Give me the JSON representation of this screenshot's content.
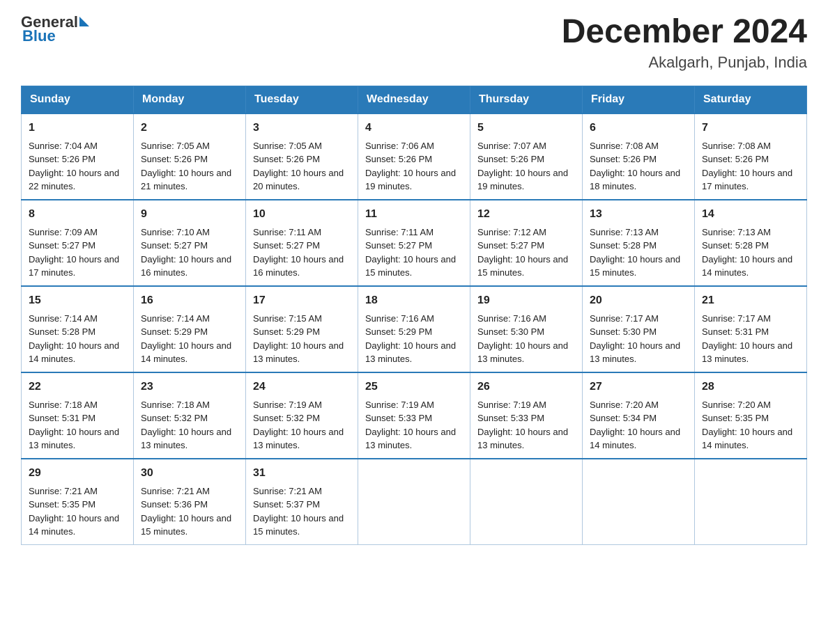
{
  "header": {
    "logo_general": "General",
    "logo_blue": "Blue",
    "title": "December 2024",
    "subtitle": "Akalgarh, Punjab, India"
  },
  "days": [
    "Sunday",
    "Monday",
    "Tuesday",
    "Wednesday",
    "Thursday",
    "Friday",
    "Saturday"
  ],
  "weeks": [
    [
      {
        "num": "1",
        "sunrise": "7:04 AM",
        "sunset": "5:26 PM",
        "daylight": "10 hours and 22 minutes."
      },
      {
        "num": "2",
        "sunrise": "7:05 AM",
        "sunset": "5:26 PM",
        "daylight": "10 hours and 21 minutes."
      },
      {
        "num": "3",
        "sunrise": "7:05 AM",
        "sunset": "5:26 PM",
        "daylight": "10 hours and 20 minutes."
      },
      {
        "num": "4",
        "sunrise": "7:06 AM",
        "sunset": "5:26 PM",
        "daylight": "10 hours and 19 minutes."
      },
      {
        "num": "5",
        "sunrise": "7:07 AM",
        "sunset": "5:26 PM",
        "daylight": "10 hours and 19 minutes."
      },
      {
        "num": "6",
        "sunrise": "7:08 AM",
        "sunset": "5:26 PM",
        "daylight": "10 hours and 18 minutes."
      },
      {
        "num": "7",
        "sunrise": "7:08 AM",
        "sunset": "5:26 PM",
        "daylight": "10 hours and 17 minutes."
      }
    ],
    [
      {
        "num": "8",
        "sunrise": "7:09 AM",
        "sunset": "5:27 PM",
        "daylight": "10 hours and 17 minutes."
      },
      {
        "num": "9",
        "sunrise": "7:10 AM",
        "sunset": "5:27 PM",
        "daylight": "10 hours and 16 minutes."
      },
      {
        "num": "10",
        "sunrise": "7:11 AM",
        "sunset": "5:27 PM",
        "daylight": "10 hours and 16 minutes."
      },
      {
        "num": "11",
        "sunrise": "7:11 AM",
        "sunset": "5:27 PM",
        "daylight": "10 hours and 15 minutes."
      },
      {
        "num": "12",
        "sunrise": "7:12 AM",
        "sunset": "5:27 PM",
        "daylight": "10 hours and 15 minutes."
      },
      {
        "num": "13",
        "sunrise": "7:13 AM",
        "sunset": "5:28 PM",
        "daylight": "10 hours and 15 minutes."
      },
      {
        "num": "14",
        "sunrise": "7:13 AM",
        "sunset": "5:28 PM",
        "daylight": "10 hours and 14 minutes."
      }
    ],
    [
      {
        "num": "15",
        "sunrise": "7:14 AM",
        "sunset": "5:28 PM",
        "daylight": "10 hours and 14 minutes."
      },
      {
        "num": "16",
        "sunrise": "7:14 AM",
        "sunset": "5:29 PM",
        "daylight": "10 hours and 14 minutes."
      },
      {
        "num": "17",
        "sunrise": "7:15 AM",
        "sunset": "5:29 PM",
        "daylight": "10 hours and 13 minutes."
      },
      {
        "num": "18",
        "sunrise": "7:16 AM",
        "sunset": "5:29 PM",
        "daylight": "10 hours and 13 minutes."
      },
      {
        "num": "19",
        "sunrise": "7:16 AM",
        "sunset": "5:30 PM",
        "daylight": "10 hours and 13 minutes."
      },
      {
        "num": "20",
        "sunrise": "7:17 AM",
        "sunset": "5:30 PM",
        "daylight": "10 hours and 13 minutes."
      },
      {
        "num": "21",
        "sunrise": "7:17 AM",
        "sunset": "5:31 PM",
        "daylight": "10 hours and 13 minutes."
      }
    ],
    [
      {
        "num": "22",
        "sunrise": "7:18 AM",
        "sunset": "5:31 PM",
        "daylight": "10 hours and 13 minutes."
      },
      {
        "num": "23",
        "sunrise": "7:18 AM",
        "sunset": "5:32 PM",
        "daylight": "10 hours and 13 minutes."
      },
      {
        "num": "24",
        "sunrise": "7:19 AM",
        "sunset": "5:32 PM",
        "daylight": "10 hours and 13 minutes."
      },
      {
        "num": "25",
        "sunrise": "7:19 AM",
        "sunset": "5:33 PM",
        "daylight": "10 hours and 13 minutes."
      },
      {
        "num": "26",
        "sunrise": "7:19 AM",
        "sunset": "5:33 PM",
        "daylight": "10 hours and 13 minutes."
      },
      {
        "num": "27",
        "sunrise": "7:20 AM",
        "sunset": "5:34 PM",
        "daylight": "10 hours and 14 minutes."
      },
      {
        "num": "28",
        "sunrise": "7:20 AM",
        "sunset": "5:35 PM",
        "daylight": "10 hours and 14 minutes."
      }
    ],
    [
      {
        "num": "29",
        "sunrise": "7:21 AM",
        "sunset": "5:35 PM",
        "daylight": "10 hours and 14 minutes."
      },
      {
        "num": "30",
        "sunrise": "7:21 AM",
        "sunset": "5:36 PM",
        "daylight": "10 hours and 15 minutes."
      },
      {
        "num": "31",
        "sunrise": "7:21 AM",
        "sunset": "5:37 PM",
        "daylight": "10 hours and 15 minutes."
      },
      null,
      null,
      null,
      null
    ]
  ]
}
